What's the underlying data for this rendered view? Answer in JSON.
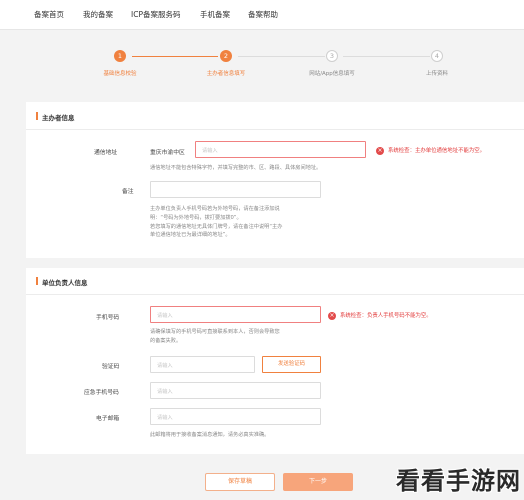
{
  "topnav": {
    "items": [
      "备案首页",
      "我的备案",
      "ICP备案服务码",
      "手机备案",
      "备案帮助"
    ]
  },
  "steps": [
    {
      "num": "1",
      "label": "基础信息校验",
      "state": "done"
    },
    {
      "num": "2",
      "label": "主办者信息填写",
      "state": "active"
    },
    {
      "num": "3",
      "label": "网站/App信息填写",
      "state": "todo"
    },
    {
      "num": "4",
      "label": "上传资料",
      "state": "todo"
    }
  ],
  "sponsor": {
    "title": "主办者信息",
    "address": {
      "label": "通信地址",
      "prefix": "重庆市渝中区",
      "placeholder": "请输入",
      "error": "系统检查：主办单位通信地址不能为空。",
      "hint": "通信地址不能包含特殊字符，并填写完整的市、区、路段、具体房间地址。"
    },
    "remark": {
      "label": "备注",
      "placeholder": "",
      "hint": [
        "主办单位负责人手机号码若为外地号码，请在备注添加说",
        "明：“号码为外地号码，拨打要加拨0”。",
        "若您填写的通信地址无具体门牌号，请在备注中说明“主办",
        "单位通信地址已为最详细的地址”。"
      ]
    }
  },
  "leader": {
    "title": "单位负责人信息",
    "phone": {
      "label": "手机号码",
      "placeholder": "请输入",
      "error": "系统检查：负责人手机号码不能为空。",
      "hint": [
        "请确保填写的手机号码可直接联系到本人，否则会导致您",
        "的备案失败。"
      ]
    },
    "code": {
      "label": "验证码",
      "placeholder": "请输入",
      "button": "发送验证码"
    },
    "emergency": {
      "label": "应急手机号码",
      "placeholder": "请输入"
    },
    "email": {
      "label": "电子邮箱",
      "placeholder": "请输入",
      "hint": "此邮箱将用于接收备案消息通知，请务必真实准确。"
    }
  },
  "footer": {
    "save_label": "保存草稿",
    "next_label": "下一步"
  },
  "watermark": {
    "text": "看看手游网"
  },
  "colors": {
    "accent": "#f0813f",
    "error": "#e23b3b"
  }
}
